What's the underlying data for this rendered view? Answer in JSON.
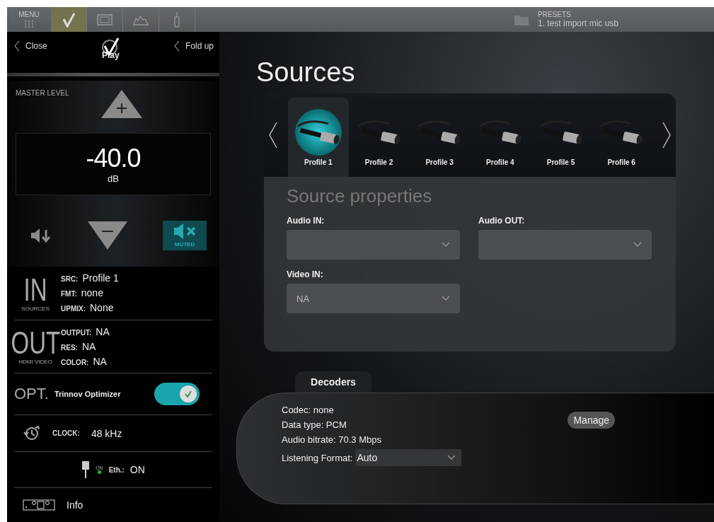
{
  "top_bar": {
    "menu_label": "MENU",
    "tabs": [
      {
        "kind": "check",
        "selected": true
      },
      {
        "kind": "screen",
        "selected": false
      },
      {
        "kind": "curve",
        "selected": false
      },
      {
        "kind": "mic",
        "selected": false
      }
    ],
    "presets": {
      "label": "PRESETS",
      "value": "1. test import mic usb"
    }
  },
  "left_panel": {
    "close": "Close",
    "logo_text": "Play",
    "fold_up": "Fold up",
    "master_label": "MASTER LEVEL",
    "volume": {
      "value": "-40.0",
      "unit": "dB"
    },
    "muted": true,
    "mute_label": "MUTED",
    "in": {
      "big": "IN",
      "caption": "SOURCES",
      "rows": [
        {
          "key": "SRC:",
          "value": "Profile 1"
        },
        {
          "key": "FMT:",
          "value": "none"
        },
        {
          "key": "UPMIX:",
          "value": "None"
        }
      ]
    },
    "out": {
      "big": "OUT",
      "caption": "HDMI VIDEO",
      "rows": [
        {
          "key": "OUTPUT:",
          "value": "NA"
        },
        {
          "key": "RES:",
          "value": "NA"
        },
        {
          "key": "COLOR:",
          "value": "NA"
        }
      ]
    },
    "opt": {
      "big": "OPT.",
      "label": "Trinnov Optimizer",
      "on": true
    },
    "clock": {
      "key": "CLOCK:",
      "value": "48 kHz"
    },
    "eth": {
      "icon_label": "ON",
      "key": "Eth.:",
      "value": "ON"
    },
    "info": "Info"
  },
  "main": {
    "title": "Sources",
    "profiles": [
      {
        "label": "Profile 1",
        "selected": true
      },
      {
        "label": "Profile 2",
        "selected": false
      },
      {
        "label": "Profile 3",
        "selected": false
      },
      {
        "label": "Profile 4",
        "selected": false
      },
      {
        "label": "Profile 5",
        "selected": false
      },
      {
        "label": "Profile 6",
        "selected": false
      }
    ],
    "properties_title": "Source properties",
    "fields": [
      {
        "label": "Audio IN:"
      },
      {
        "label": "Audio OUT:"
      },
      {
        "label": "Video IN:",
        "value": "NA"
      }
    ],
    "decoders": {
      "tab": "Decoders",
      "lines": [
        "Codec: none",
        "Data type: PCM",
        "Audio bitrate: 70.3 Mbps"
      ],
      "format_label": "Listening Format:",
      "format_value": "Auto",
      "manage": "Manage"
    }
  }
}
